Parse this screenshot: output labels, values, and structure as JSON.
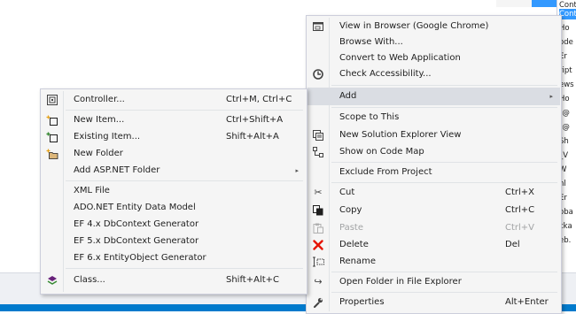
{
  "background": {
    "solution_rows": [
      "Conte",
      "Contr",
      "Ho",
      "ode",
      "Er",
      "ript",
      "ews",
      "Ho",
      "[@",
      "[@",
      "Sh",
      "_V",
      "W",
      "nl",
      "Er",
      "oba",
      "cka",
      "eb."
    ]
  },
  "context_menu": {
    "items": [
      {
        "label": "View in Browser (Google Chrome)",
        "icon": "browser-icon"
      },
      {
        "label": "Browse With..."
      },
      {
        "label": "Convert to Web Application"
      },
      {
        "label": "Check Accessibility...",
        "icon": "accessibility-icon"
      },
      {
        "label": "Add",
        "submenu_arrow": "▸"
      },
      {
        "label": "Scope to This"
      },
      {
        "label": "New Solution Explorer View",
        "icon": "solution-explorer-icon"
      },
      {
        "label": "Show on Code Map",
        "icon": "code-map-icon"
      },
      {
        "label": "Exclude From Project"
      },
      {
        "label": "Cut",
        "shortcut": "Ctrl+X",
        "icon": "scissors-icon"
      },
      {
        "label": "Copy",
        "shortcut": "Ctrl+C",
        "icon": "copy-icon"
      },
      {
        "label": "Paste",
        "shortcut": "Ctrl+V",
        "icon": "paste-icon",
        "disabled": true
      },
      {
        "label": "Delete",
        "shortcut": "Del",
        "icon": "delete-icon"
      },
      {
        "label": "Rename",
        "icon": "rename-icon"
      },
      {
        "label": "Open Folder in File Explorer",
        "icon": "open-folder-icon"
      },
      {
        "label": "Properties",
        "shortcut": "Alt+Enter",
        "icon": "wrench-icon"
      }
    ]
  },
  "add_submenu": {
    "items": [
      {
        "label": "Controller...",
        "shortcut": "Ctrl+M, Ctrl+C",
        "icon": "controller-icon"
      },
      {
        "label": "New Item...",
        "shortcut": "Ctrl+Shift+A",
        "icon": "new-item-icon"
      },
      {
        "label": "Existing Item...",
        "shortcut": "Shift+Alt+A",
        "icon": "existing-item-icon"
      },
      {
        "label": "New Folder",
        "icon": "new-folder-icon"
      },
      {
        "label": "Add ASP.NET Folder",
        "submenu_arrow": "▸"
      },
      {
        "label": "XML File"
      },
      {
        "label": "ADO.NET Entity Data Model"
      },
      {
        "label": "EF 4.x DbContext Generator"
      },
      {
        "label": "EF 5.x DbContext Generator"
      },
      {
        "label": "EF 6.x EntityObject Generator"
      },
      {
        "label": "Class...",
        "shortcut": "Shift+Alt+C",
        "icon": "class-icon"
      }
    ]
  },
  "colors": {
    "menu_background": "#f5f5f5",
    "menu_highlight": "#dadde3",
    "statusbar": "#007acc",
    "selection": "#3399ff",
    "delete_red": "#e51400"
  }
}
